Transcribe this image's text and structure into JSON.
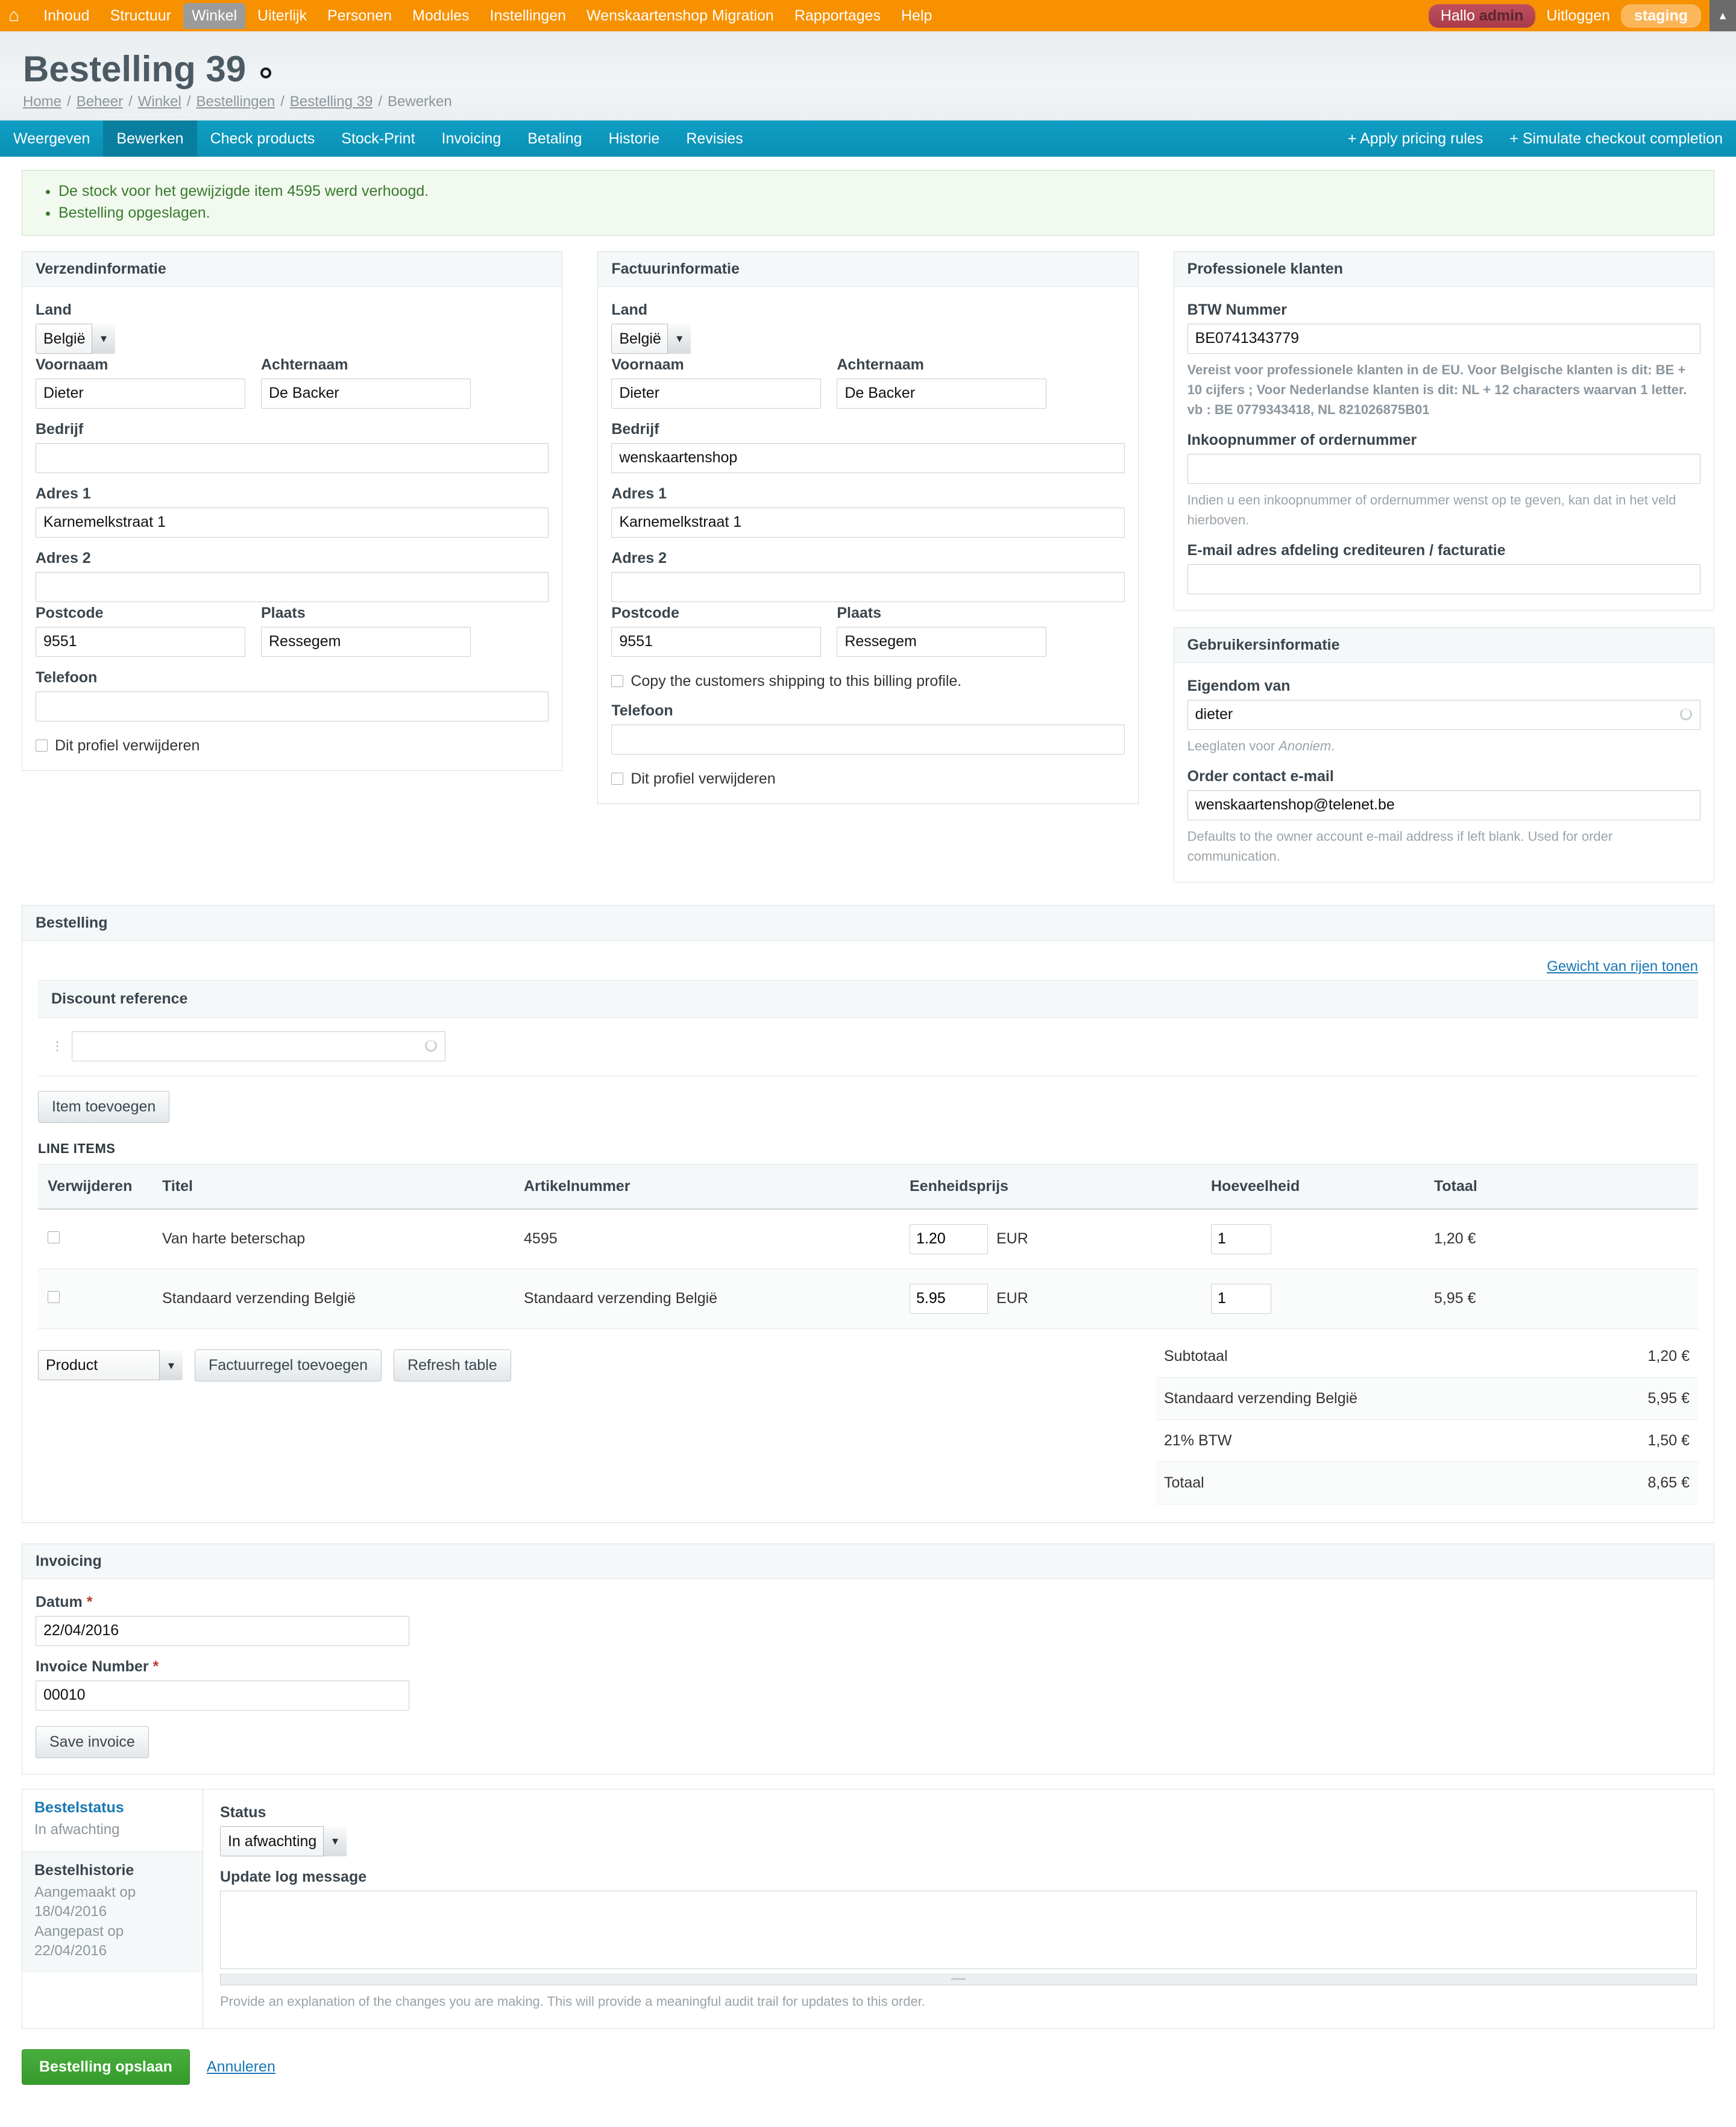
{
  "admin_bar": {
    "home_icon": "home-icon",
    "menu": [
      {
        "label": "Inhoud",
        "active": false
      },
      {
        "label": "Structuur",
        "active": false
      },
      {
        "label": "Winkel",
        "active": true
      },
      {
        "label": "Uiterlijk",
        "active": false
      },
      {
        "label": "Personen",
        "active": false
      },
      {
        "label": "Modules",
        "active": false
      },
      {
        "label": "Instellingen",
        "active": false
      },
      {
        "label": "Wenskaartenshop Migration",
        "active": false
      },
      {
        "label": "Rapportages",
        "active": false
      },
      {
        "label": "Help",
        "active": false
      }
    ],
    "greeting_prefix": "Hallo ",
    "greeting_user": "admin",
    "logout": "Uitloggen",
    "environment": "staging",
    "collapse_icon": "▲"
  },
  "page": {
    "title": "Bestelling 39",
    "breadcrumb": [
      "Home",
      "Beheer",
      "Winkel",
      "Bestellingen",
      "Bestelling 39",
      "Bewerken"
    ]
  },
  "tabs": {
    "items": [
      {
        "label": "Weergeven",
        "active": false
      },
      {
        "label": "Bewerken",
        "active": true
      },
      {
        "label": "Check products",
        "active": false
      },
      {
        "label": "Stock-Print",
        "active": false
      },
      {
        "label": "Invoicing",
        "active": false
      },
      {
        "label": "Betaling",
        "active": false
      },
      {
        "label": "Historie",
        "active": false
      },
      {
        "label": "Revisies",
        "active": false
      }
    ],
    "right_actions": [
      {
        "label": "+ Apply pricing rules"
      },
      {
        "label": "+ Simulate checkout completion"
      }
    ]
  },
  "messages": [
    "De stock voor het gewijzigde item 4595 werd verhoogd.",
    "Bestelling opgeslagen."
  ],
  "shipping": {
    "panel_title": "Verzendinformatie",
    "land_label": "Land",
    "land_value": "België",
    "voornaam_label": "Voornaam",
    "voornaam_value": "Dieter",
    "achternaam_label": "Achternaam",
    "achternaam_value": "De Backer",
    "bedrijf_label": "Bedrijf",
    "bedrijf_value": "",
    "adres1_label": "Adres 1",
    "adres1_value": "Karnemelkstraat 1",
    "adres2_label": "Adres 2",
    "adres2_value": "",
    "postcode_label": "Postcode",
    "postcode_value": "9551",
    "plaats_label": "Plaats",
    "plaats_value": "Ressegem",
    "telefoon_label": "Telefoon",
    "telefoon_value": "",
    "delete_profile_label": "Dit profiel verwijderen"
  },
  "billing": {
    "panel_title": "Factuurinformatie",
    "land_label": "Land",
    "land_value": "België",
    "voornaam_label": "Voornaam",
    "voornaam_value": "Dieter",
    "achternaam_label": "Achternaam",
    "achternaam_value": "De Backer",
    "bedrijf_label": "Bedrijf",
    "bedrijf_value": "wenskaartenshop",
    "adres1_label": "Adres 1",
    "adres1_value": "Karnemelkstraat 1",
    "adres2_label": "Adres 2",
    "adres2_value": "",
    "postcode_label": "Postcode",
    "postcode_value": "9551",
    "plaats_label": "Plaats",
    "plaats_value": "Ressegem",
    "copy_shipping_label": "Copy the customers shipping to this billing profile.",
    "telefoon_label": "Telefoon",
    "telefoon_value": "",
    "delete_profile_label": "Dit profiel verwijderen"
  },
  "professional": {
    "panel_title": "Professionele klanten",
    "btw_label": "BTW Nummer",
    "btw_value": "BE0741343779",
    "btw_help": "Vereist voor professionele klanten in de EU. Voor Belgische klanten is dit: BE + 10 cijfers ; Voor Nederlandse klanten is dit: NL + 12 characters waarvan 1 letter. vb : BE 0779343418, NL 821026875B01",
    "po_label": "Inkoopnummer of ordernummer",
    "po_value": "",
    "po_help": "Indien u een inkoopnummer of ordernummer wenst op te geven, kan dat in het veld hierboven.",
    "ap_email_label": "E-mail adres afdeling crediteuren / facturatie",
    "ap_email_value": ""
  },
  "user_info": {
    "panel_title": "Gebruikersinformatie",
    "owner_label": "Eigendom van",
    "owner_value": "dieter",
    "owner_help_pre": "Leeglaten voor ",
    "owner_help_em": "Anoniem",
    "owner_help_post": ".",
    "contact_label": "Order contact e-mail",
    "contact_value": "wenskaartenshop@telenet.be",
    "contact_help": "Defaults to the owner account e-mail address if left blank. Used for order communication."
  },
  "order": {
    "panel_title": "Bestelling",
    "weight_link": "Gewicht van rijen tonen",
    "discount_header": "Discount reference",
    "discount_value": "",
    "add_item_button": "Item toevoegen",
    "line_items_label": "LINE ITEMS",
    "columns": [
      "Verwijderen",
      "Titel",
      "Artikelnummer",
      "Eenheidsprijs",
      "Hoeveelheid",
      "Totaal"
    ],
    "rows": [
      {
        "titel": "Van harte beterschap",
        "artikelnummer": "4595",
        "eenheidsprijs": "1.20",
        "currency": "EUR",
        "hoeveelheid": "1",
        "totaal": "1,20 €"
      },
      {
        "titel": "Standaard verzending België",
        "artikelnummer": "Standaard verzending België",
        "eenheidsprijs": "5.95",
        "currency": "EUR",
        "hoeveelheid": "1",
        "totaal": "5,95 €"
      }
    ],
    "product_select_value": "Product",
    "add_invoice_line_button": "Factuurregel toevoegen",
    "refresh_table_button": "Refresh table",
    "totals": [
      {
        "label": "Subtotaal",
        "amount": "1,20 €"
      },
      {
        "label": "Standaard verzending België",
        "amount": "5,95 €"
      },
      {
        "label": "21% BTW",
        "amount": "1,50 €"
      },
      {
        "label": "Totaal",
        "amount": "8,65 €"
      }
    ]
  },
  "invoicing": {
    "panel_title": "Invoicing",
    "datum_label": "Datum",
    "datum_required": "*",
    "datum_value": "22/04/2016",
    "invoice_number_label": "Invoice Number",
    "invoice_number_required": "*",
    "invoice_number_value": "00010",
    "save_invoice_button": "Save invoice"
  },
  "status": {
    "bestelstatus_title": "Bestelstatus",
    "bestelstatus_value": "In afwachting",
    "bestelhistorie_title": "Bestelhistorie",
    "created_text": "Aangemaakt op 18/04/2016",
    "updated_text": "Aangepast op 22/04/2016",
    "status_label": "Status",
    "status_value": "In afwachting",
    "log_label": "Update log message",
    "log_value": "",
    "log_help": "Provide an explanation of the changes you are making. This will provide a meaningful audit trail for updates to this order."
  },
  "footer": {
    "save_button": "Bestelling opslaan",
    "cancel_link": "Annuleren"
  },
  "colors": {
    "admin_bar": "#f79100",
    "tab_bar": "#0f9fc4",
    "tab_active": "#0a7e9e",
    "save_green": "#349b2b",
    "link_blue": "#1878b4",
    "message_green": "#3a7a2c",
    "required_red": "#c0392b"
  }
}
